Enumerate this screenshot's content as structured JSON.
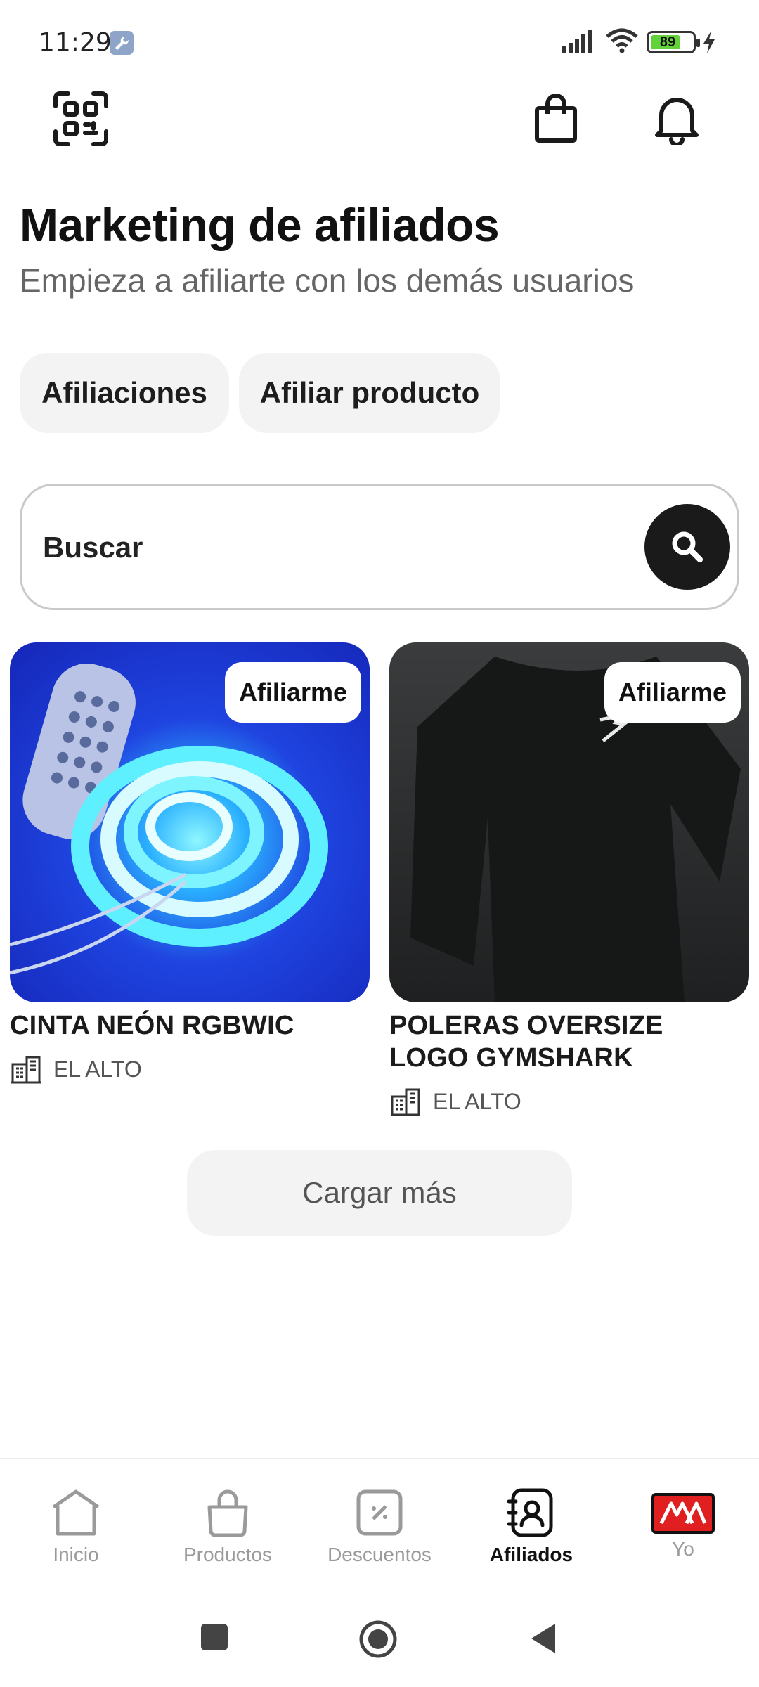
{
  "status_bar": {
    "time": "11:29",
    "battery": "89"
  },
  "header": {
    "title": "Marketing de afiliados",
    "subtitle": "Empieza a afiliarte con los demás usuarios"
  },
  "tabs": [
    {
      "label": "Afiliaciones"
    },
    {
      "label": "Afiliar producto"
    }
  ],
  "search": {
    "placeholder": "Buscar"
  },
  "products": [
    {
      "name": "CINTA NEÓN RGBWIC",
      "location": "EL ALTO",
      "action": "Afiliarme"
    },
    {
      "name": "POLERAS OVERSIZE LOGO GYMSHARK",
      "location": "EL ALTO",
      "action": "Afiliarme"
    }
  ],
  "load_more": "Cargar más",
  "bottom_nav": [
    {
      "label": "Inicio"
    },
    {
      "label": "Productos"
    },
    {
      "label": "Descuentos"
    },
    {
      "label": "Afiliados",
      "active": true
    },
    {
      "label": "Yo"
    }
  ],
  "colors": {
    "active": "#111111",
    "inactive": "#9a9a9a",
    "brand_red": "#e02020",
    "battery_green": "#62d23a"
  }
}
